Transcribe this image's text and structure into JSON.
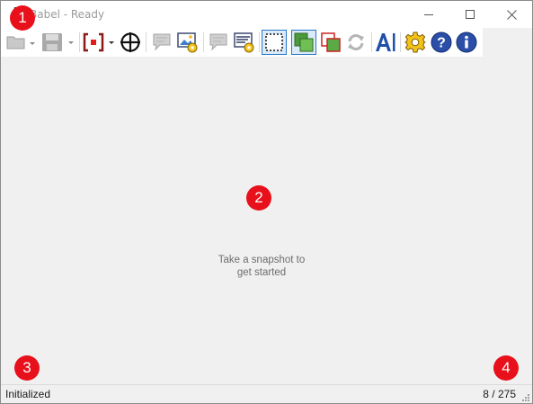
{
  "window": {
    "title": "Babel - Ready",
    "controls": {
      "minimize": "minimize-icon",
      "maximize": "maximize-icon",
      "close": "close-icon"
    }
  },
  "toolbar": {
    "buttons": [
      {
        "id": "open",
        "icon": "folder-open-icon",
        "enabled": false,
        "has_dropdown": true
      },
      {
        "id": "save",
        "icon": "save-icon",
        "enabled": false,
        "has_dropdown": true
      },
      {
        "id": "capture-region",
        "icon": "capture-region-icon",
        "enabled": true,
        "has_dropdown": true
      },
      {
        "id": "crosshair",
        "icon": "crosshair-icon",
        "enabled": true
      },
      {
        "id": "speak",
        "icon": "speech-bubble-icon",
        "enabled": false
      },
      {
        "id": "image-settings",
        "icon": "image-settings-icon",
        "enabled": true
      },
      {
        "id": "text",
        "icon": "text-bubble-icon",
        "enabled": false
      },
      {
        "id": "text-settings",
        "icon": "text-settings-icon",
        "enabled": true
      },
      {
        "id": "select-area",
        "icon": "select-area-icon",
        "enabled": true,
        "toggled": true
      },
      {
        "id": "overlay-green",
        "icon": "overlay-green-icon",
        "enabled": true,
        "toggled": true
      },
      {
        "id": "overlay-red",
        "icon": "overlay-red-icon",
        "enabled": true
      },
      {
        "id": "refresh",
        "icon": "refresh-icon",
        "enabled": false
      },
      {
        "id": "font",
        "icon": "font-icon",
        "enabled": true
      },
      {
        "id": "settings",
        "icon": "gear-icon",
        "enabled": true
      },
      {
        "id": "help",
        "icon": "help-icon",
        "enabled": true
      },
      {
        "id": "about",
        "icon": "info-icon",
        "enabled": true
      }
    ]
  },
  "main": {
    "empty_message_line1": "Take a snapshot to",
    "empty_message_line2": "get started"
  },
  "status": {
    "left": "Initialized",
    "right": "8 / 275"
  },
  "markers": [
    "1",
    "2",
    "3",
    "4"
  ],
  "colors": {
    "marker_red": "#e8101a",
    "toolbar_bg": "#ffffff",
    "client_bg": "#f0f0f0",
    "accent_blue": "#1f4fa8"
  }
}
